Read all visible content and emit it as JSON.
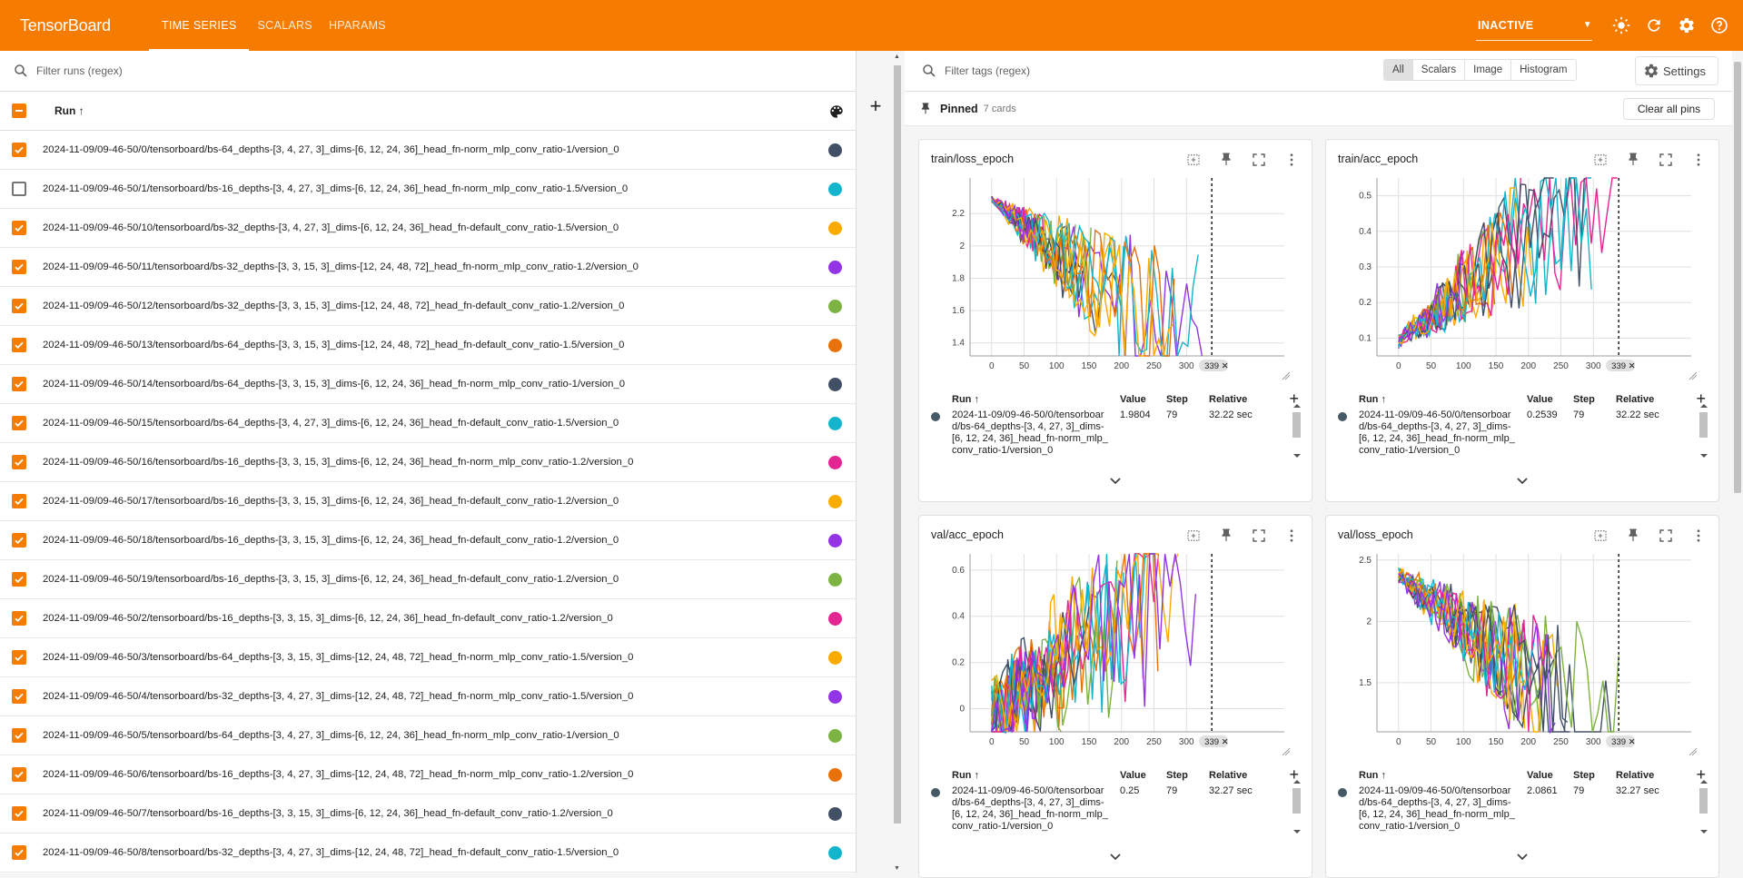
{
  "header": {
    "brand": "TensorBoard",
    "tabs": [
      "TIME SERIES",
      "SCALARS",
      "HPARAMS"
    ],
    "status_select": "INACTIVE"
  },
  "runs_panel": {
    "filter_placeholder": "Filter runs (regex)",
    "column_header": "Run ↑",
    "rows": [
      {
        "label": "2024-11-09/09-46-50/0/tensorboard/bs-64_depths-[3, 4, 27, 3]_dims-[6, 12, 24, 36]_head_fn-norm_mlp_conv_ratio-1/version_0",
        "checked": true,
        "color": "#425066"
      },
      {
        "label": "2024-11-09/09-46-50/1/tensorboard/bs-16_depths-[3, 4, 27, 3]_dims-[6, 12, 24, 36]_head_fn-norm_mlp_conv_ratio-1.5/version_0",
        "checked": false,
        "color": "#12b5cb"
      },
      {
        "label": "2024-11-09/09-46-50/10/tensorboard/bs-32_depths-[3, 4, 27, 3]_dims-[6, 12, 24, 36]_head_fn-default_conv_ratio-1.5/version_0",
        "checked": true,
        "color": "#f9ab00"
      },
      {
        "label": "2024-11-09/09-46-50/11/tensorboard/bs-32_depths-[3, 3, 15, 3]_dims-[12, 24, 48, 72]_head_fn-norm_mlp_conv_ratio-1.2/version_0",
        "checked": true,
        "color": "#9334e6"
      },
      {
        "label": "2024-11-09/09-46-50/12/tensorboard/bs-32_depths-[3, 3, 15, 3]_dims-[12, 24, 48, 72]_head_fn-default_conv_ratio-1.2/version_0",
        "checked": true,
        "color": "#7cb342"
      },
      {
        "label": "2024-11-09/09-46-50/13/tensorboard/bs-64_depths-[3, 3, 15, 3]_dims-[12, 24, 48, 72]_head_fn-default_conv_ratio-1.5/version_0",
        "checked": true,
        "color": "#e8710a"
      },
      {
        "label": "2024-11-09/09-46-50/14/tensorboard/bs-64_depths-[3, 3, 15, 3]_dims-[6, 12, 24, 36]_head_fn-norm_mlp_conv_ratio-1/version_0",
        "checked": true,
        "color": "#425066"
      },
      {
        "label": "2024-11-09/09-46-50/15/tensorboard/bs-64_depths-[3, 4, 27, 3]_dims-[6, 12, 24, 36]_head_fn-default_conv_ratio-1.5/version_0",
        "checked": true,
        "color": "#12b5cb"
      },
      {
        "label": "2024-11-09/09-46-50/16/tensorboard/bs-16_depths-[3, 3, 15, 3]_dims-[6, 12, 24, 36]_head_fn-norm_mlp_conv_ratio-1.2/version_0",
        "checked": true,
        "color": "#e52592"
      },
      {
        "label": "2024-11-09/09-46-50/17/tensorboard/bs-16_depths-[3, 3, 15, 3]_dims-[6, 12, 24, 36]_head_fn-default_conv_ratio-1.2/version_0",
        "checked": true,
        "color": "#f9ab00"
      },
      {
        "label": "2024-11-09/09-46-50/18/tensorboard/bs-16_depths-[3, 3, 15, 3]_dims-[6, 12, 24, 36]_head_fn-default_conv_ratio-1.2/version_0",
        "checked": true,
        "color": "#9334e6"
      },
      {
        "label": "2024-11-09/09-46-50/19/tensorboard/bs-16_depths-[3, 3, 15, 3]_dims-[6, 12, 24, 36]_head_fn-default_conv_ratio-1.2/version_0",
        "checked": true,
        "color": "#7cb342"
      },
      {
        "label": "2024-11-09/09-46-50/2/tensorboard/bs-16_depths-[3, 3, 15, 3]_dims-[6, 12, 24, 36]_head_fn-default_conv_ratio-1.2/version_0",
        "checked": true,
        "color": "#e52592"
      },
      {
        "label": "2024-11-09/09-46-50/3/tensorboard/bs-64_depths-[3, 3, 15, 3]_dims-[12, 24, 48, 72]_head_fn-norm_mlp_conv_ratio-1.5/version_0",
        "checked": true,
        "color": "#f9ab00"
      },
      {
        "label": "2024-11-09/09-46-50/4/tensorboard/bs-32_depths-[3, 4, 27, 3]_dims-[12, 24, 48, 72]_head_fn-norm_mlp_conv_ratio-1.5/version_0",
        "checked": true,
        "color": "#9334e6"
      },
      {
        "label": "2024-11-09/09-46-50/5/tensorboard/bs-64_depths-[3, 4, 27, 3]_dims-[6, 12, 24, 36]_head_fn-norm_mlp_conv_ratio-1/version_0",
        "checked": true,
        "color": "#7cb342"
      },
      {
        "label": "2024-11-09/09-46-50/6/tensorboard/bs-16_depths-[3, 4, 27, 3]_dims-[12, 24, 48, 72]_head_fn-norm_mlp_conv_ratio-1.2/version_0",
        "checked": true,
        "color": "#e8710a"
      },
      {
        "label": "2024-11-09/09-46-50/7/tensorboard/bs-16_depths-[3, 3, 15, 3]_dims-[6, 12, 24, 36]_head_fn-default_conv_ratio-1.2/version_0",
        "checked": true,
        "color": "#425066"
      },
      {
        "label": "2024-11-09/09-46-50/8/tensorboard/bs-32_depths-[3, 4, 27, 3]_dims-[12, 24, 48, 72]_head_fn-default_conv_ratio-1.5/version_0",
        "checked": true,
        "color": "#12b5cb"
      }
    ]
  },
  "tags_panel": {
    "filter_placeholder": "Filter tags (regex)",
    "type_filters": [
      "All",
      "Scalars",
      "Image",
      "Histogram"
    ],
    "selected_filter": "All",
    "settings_label": "Settings",
    "pinned_label": "Pinned",
    "pinned_count": "7 cards",
    "clear_pins_label": "Clear all pins"
  },
  "cards": [
    {
      "title": "train/loss_epoch",
      "value": "1.9804",
      "step": "79",
      "relative": "32.22 sec",
      "run": "2024-11-09/09-46-50/0/tensorboard/bs-64_depths-[3, 4, 27, 3]_dims-[6, 12, 24, 36]_head_fn-norm_mlp_conv_ratio-1/version_0"
    },
    {
      "title": "train/acc_epoch",
      "value": "0.2539",
      "step": "79",
      "relative": "32.22 sec",
      "run": "2024-11-09/09-46-50/0/tensorboard/bs-64_depths-[3, 4, 27, 3]_dims-[6, 12, 24, 36]_head_fn-norm_mlp_conv_ratio-1/version_0"
    },
    {
      "title": "val/acc_epoch",
      "value": "0.25",
      "step": "79",
      "relative": "32.27 sec",
      "run": "2024-11-09/09-46-50/0/tensorboard/bs-64_depths-[3, 4, 27, 3]_dims-[6, 12, 24, 36]_head_fn-norm_mlp_conv_ratio-1/version_0"
    },
    {
      "title": "val/loss_epoch",
      "value": "2.0861",
      "step": "79",
      "relative": "32.27 sec",
      "run": "2024-11-09/09-46-50/0/tensorboard/bs-64_depths-[3, 4, 27, 3]_dims-[6, 12, 24, 36]_head_fn-norm_mlp_conv_ratio-1/version_0"
    }
  ],
  "card_table": {
    "col_run": "Run ↑",
    "col_value": "Value",
    "col_step": "Step",
    "col_relative": "Relative"
  },
  "chart_data": [
    {
      "type": "line",
      "title": "train/loss_epoch",
      "x_ticks": [
        "0",
        "50",
        "100",
        "150",
        "200",
        "250",
        "300"
      ],
      "y_ticks": [
        "1.4",
        "1.6",
        "1.8",
        "2",
        "2.2"
      ],
      "ylim": [
        1.32,
        2.42
      ],
      "xlim": [
        -50,
        400
      ],
      "step_marker": "339"
    },
    {
      "type": "line",
      "title": "train/acc_epoch",
      "x_ticks": [
        "0",
        "50",
        "100",
        "150",
        "200",
        "250",
        "300"
      ],
      "y_ticks": [
        "0.1",
        "0.2",
        "0.3",
        "0.4",
        "0.5"
      ],
      "ylim": [
        0.05,
        0.55
      ],
      "xlim": [
        -50,
        400
      ],
      "step_marker": "339"
    },
    {
      "type": "line",
      "title": "val/acc_epoch",
      "x_ticks": [
        "0",
        "50",
        "100",
        "150",
        "200",
        "250",
        "300"
      ],
      "y_ticks": [
        "0",
        "0.2",
        "0.4",
        "0.6"
      ],
      "ylim": [
        -0.1,
        0.67
      ],
      "xlim": [
        -50,
        400
      ],
      "step_marker": "339"
    },
    {
      "type": "line",
      "title": "val/loss_epoch",
      "x_ticks": [
        "0",
        "50",
        "100",
        "150",
        "200",
        "250",
        "300"
      ],
      "y_ticks": [
        "1.5",
        "2",
        "2.5"
      ],
      "ylim": [
        1.1,
        2.55
      ],
      "xlim": [
        -50,
        400
      ],
      "step_marker": "339"
    }
  ],
  "series_colors": [
    "#425066",
    "#12b5cb",
    "#f9ab00",
    "#9334e6",
    "#7cb342",
    "#e8710a",
    "#e52592"
  ]
}
